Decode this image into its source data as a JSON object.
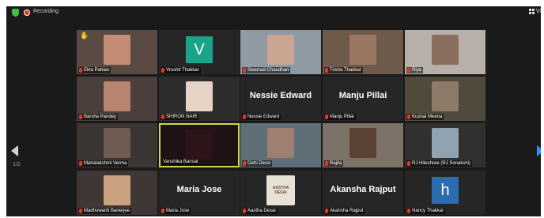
{
  "topbar": {
    "recording_label": "Recording",
    "view_label": "Vi",
    "icons": [
      "shield-icon",
      "recording-dot-icon",
      "grid-view-icon"
    ]
  },
  "pager": {
    "left_label": "1/2"
  },
  "colors": {
    "background": "#1a1a1a",
    "tile": "#262626",
    "active_speaker_border": "#c9d84d",
    "muted_icon": "#e0392b",
    "next_arrow": "#2d8cff",
    "shield": "#3fbf4a"
  },
  "participants": [
    {
      "name": "Ekta Pahlan",
      "type": "video",
      "muted": true,
      "hand_raised": true,
      "tint": "#5a4a44",
      "thumb": "#c28d74"
    },
    {
      "name": "Vrushti Thakkar",
      "type": "avatar",
      "muted": true,
      "letter": "V",
      "avatar_color": "#1aa58a"
    },
    {
      "name": "Swarnali Chaudhari",
      "type": "video",
      "muted": true,
      "tint": "#8f9aa3",
      "thumb": "#c9a592"
    },
    {
      "name": "Trisha Thakkar",
      "type": "video",
      "muted": true,
      "tint": "#6f5b4c",
      "thumb": "#9a7760"
    },
    {
      "name": "Riya",
      "type": "video",
      "muted": true,
      "tint": "#b7b0a8",
      "thumb": "#8b6e60"
    },
    {
      "name": "Barsha Pandey",
      "type": "video",
      "muted": true,
      "tint": "#4a3f3a",
      "thumb": "#b7856f"
    },
    {
      "name": "SHIRON NAIR",
      "type": "video",
      "muted": true,
      "tint": "#2d2d2d",
      "thumb": "#e7d3c5"
    },
    {
      "name": "Nessie Edward",
      "type": "name",
      "muted": true,
      "display": "Nessie Edward"
    },
    {
      "name": "Manju Pillai",
      "type": "name",
      "muted": true,
      "display": "Manju Pillai"
    },
    {
      "name": "Kushal Meena",
      "type": "video",
      "muted": true,
      "tint": "#4f4a3b",
      "thumb": "#8e7a68"
    },
    {
      "name": "Mahalakshmi Verma",
      "type": "video",
      "muted": true,
      "tint": "#3b3533",
      "thumb": "#6f5b52"
    },
    {
      "name": "Vanshika Bansal",
      "type": "video",
      "muted": false,
      "active": true,
      "tint": "#1f1215",
      "thumb": "#2c1418"
    },
    {
      "name": "Gehi Dessi",
      "type": "video",
      "muted": true,
      "tint": "#5f6f78",
      "thumb": "#9e7f70"
    },
    {
      "name": "Rajita",
      "type": "video",
      "muted": true,
      "tint": "#7c7268",
      "thumb": "#5a4237"
    },
    {
      "name": "RJ Hiteshree (RJ Sonakshi)",
      "type": "video",
      "muted": true,
      "tint": "#30302e",
      "thumb": "#8fa3b0"
    },
    {
      "name": "Madhuwanti Banerjee",
      "type": "video",
      "muted": true,
      "tint": "#3f3733",
      "thumb": "#caa27f"
    },
    {
      "name": "Maria Jose",
      "type": "name",
      "muted": true,
      "display": "Maria Jose"
    },
    {
      "name": "Aastha Desai",
      "type": "video",
      "muted": true,
      "tint": "#262626",
      "thumb": "#e8e2d6",
      "thumb_text": "AASTHA DESAI"
    },
    {
      "name": "Akansha Rajput",
      "type": "name",
      "muted": true,
      "display": "Akansha Rajput"
    },
    {
      "name": "Nancy Thakkar",
      "type": "avatar",
      "muted": true,
      "letter": "h",
      "avatar_color": "#2b6cb0"
    }
  ]
}
